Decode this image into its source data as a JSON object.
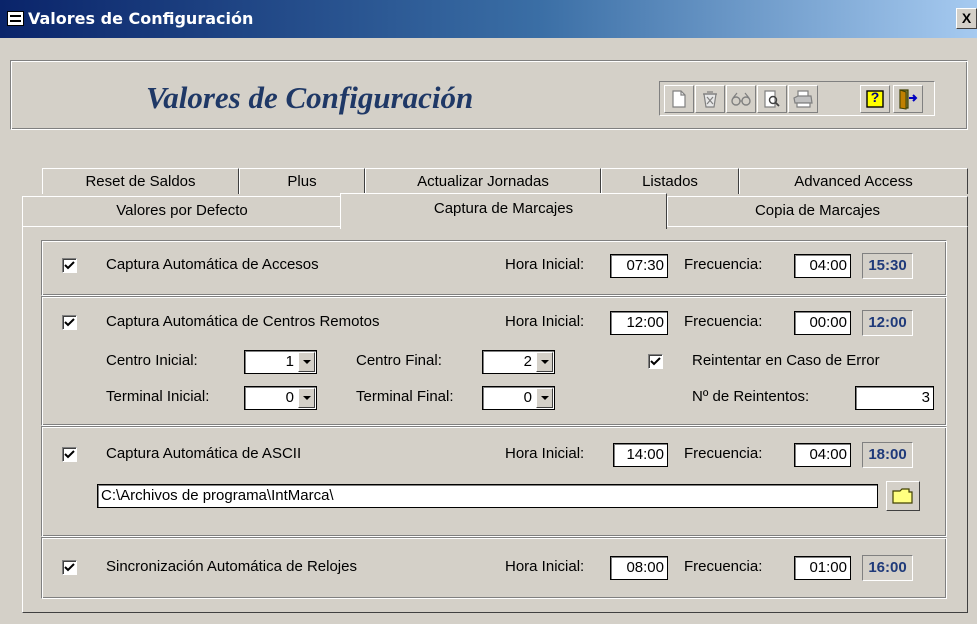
{
  "window": {
    "title": "Valores de Configuración",
    "close_label": "X"
  },
  "header": {
    "title": "Valores de Configuración"
  },
  "toolbar": {
    "buttons": [
      {
        "icon": "new-document-icon"
      },
      {
        "icon": "delete-icon"
      },
      {
        "icon": "find-icon"
      },
      {
        "icon": "print-preview-icon"
      },
      {
        "icon": "print-icon"
      },
      {
        "icon": "help-icon",
        "label": "?"
      },
      {
        "icon": "exit-icon"
      }
    ]
  },
  "tabs": {
    "row1": [
      "Reset de Saldos",
      "Plus",
      "Actualizar Jornadas",
      "Listados",
      "Advanced Access"
    ],
    "row2": [
      "Valores por Defecto",
      "Captura de Marcajes",
      "Copia de Marcajes"
    ],
    "active": "Captura de Marcajes"
  },
  "groups": {
    "accesos": {
      "checked": true,
      "label": "Captura Automática de Accesos",
      "hora_label": "Hora Inicial:",
      "hora": "07:30",
      "freq_label": "Frecuencia:",
      "freq": "04:00",
      "result": "15:30"
    },
    "remotos": {
      "checked": true,
      "label": "Captura Automática de Centros Remotos",
      "hora_label": "Hora Inicial:",
      "hora": "12:00",
      "freq_label": "Frecuencia:",
      "freq": "00:00",
      "result": "12:00",
      "centro_inicial_label": "Centro Inicial:",
      "centro_inicial": "1",
      "centro_final_label": "Centro Final:",
      "centro_final": "2",
      "terminal_inicial_label": "Terminal Inicial:",
      "terminal_inicial": "0",
      "terminal_final_label": "Terminal Final:",
      "terminal_final": "0",
      "reintentar_checked": true,
      "reintentar_label": "Reintentar en Caso de Error",
      "reintentos_label": "Nº de Reintentos:",
      "reintentos": "3"
    },
    "ascii": {
      "checked": true,
      "label": "Captura Automática de ASCII",
      "hora_label": "Hora Inicial:",
      "hora": "14:00",
      "freq_label": "Frecuencia:",
      "freq": "04:00",
      "result": "18:00",
      "path": "C:\\Archivos de programa\\IntMarca\\"
    },
    "relojes": {
      "checked": true,
      "label": "Sincronización Automática de Relojes",
      "hora_label": "Hora Inicial:",
      "hora": "08:00",
      "freq_label": "Frecuencia:",
      "freq": "01:00",
      "result": "16:00"
    }
  },
  "colors": {
    "titlebar": "#0a246a",
    "header_title": "#1f3866",
    "time_result": "#1f3a7a",
    "face": "#d4d0c8"
  }
}
